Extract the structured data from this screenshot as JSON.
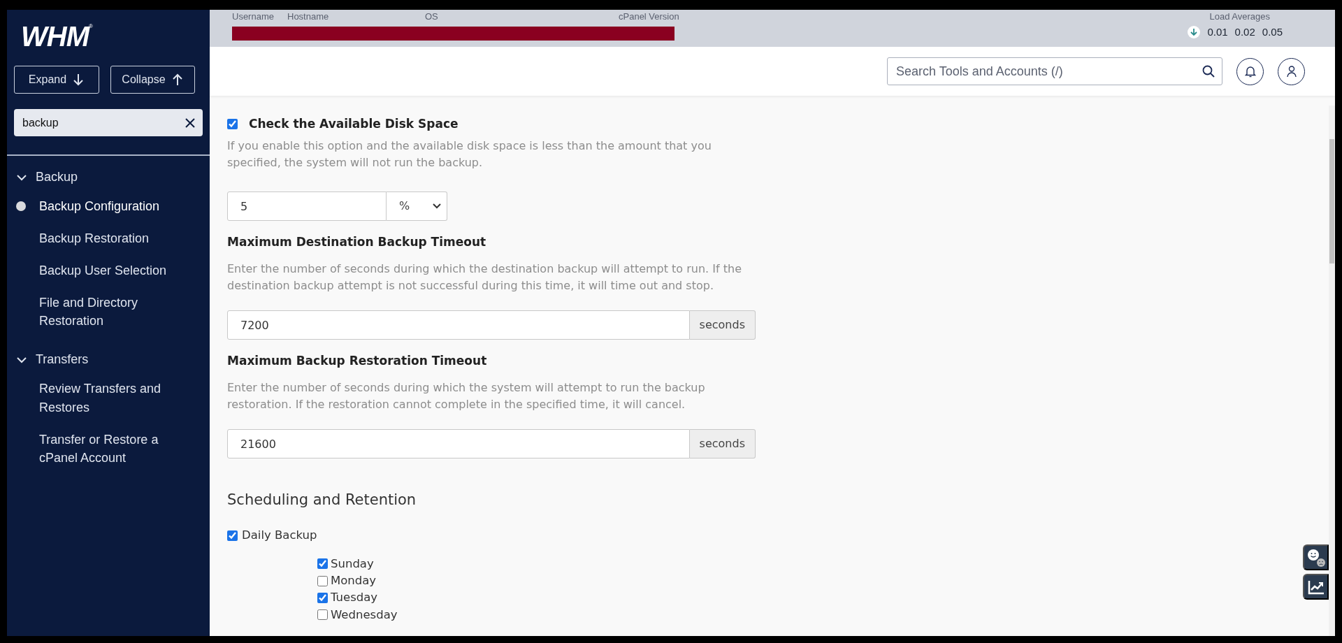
{
  "sidebar": {
    "logo": "WHM",
    "logo_mark": "®",
    "expand_button": "Expand",
    "collapse_button": "Collapse",
    "filter": {
      "value": "backup"
    },
    "groups": [
      {
        "label": "Backup",
        "expanded": true,
        "children": [
          {
            "label": "Backup Configuration",
            "selected": true
          },
          {
            "label": "Backup Restoration",
            "selected": false
          },
          {
            "label": "Backup User Selection",
            "selected": false
          },
          {
            "label": "File and Directory Restoration",
            "selected": false
          }
        ]
      },
      {
        "label": "Transfers",
        "expanded": true,
        "children": [
          {
            "label": "Review Transfers and Restores",
            "selected": false
          },
          {
            "label": "Transfer or Restore a cPanel Account",
            "selected": false
          }
        ]
      }
    ]
  },
  "server_info": {
    "columns": [
      "Username",
      "Hostname",
      "OS",
      "cPanel Version"
    ],
    "load_averages": {
      "label": "Load Averages",
      "values": [
        "0.01",
        "0.02",
        "0.05"
      ]
    }
  },
  "search": {
    "placeholder": "Search Tools and Accounts (/)"
  },
  "disk_space": {
    "label": "Check the Available Disk Space",
    "checked": true,
    "description": "If you enable this option and the available disk space is less than the amount that you specified, the system will not run the backup.",
    "value": "5",
    "unit": "%"
  },
  "timeouts": [
    {
      "heading": "Maximum Destination Backup Timeout",
      "description": "Enter the number of seconds during which the destination backup will attempt to run. If the destination backup attempt is not successful during this time, it will time out and stop.",
      "value": "7200",
      "unit": "seconds"
    },
    {
      "heading": "Maximum Backup Restoration Timeout",
      "description": "Enter the number of seconds during which the system will attempt to run the backup restoration. If the restoration cannot complete in the specified time, it will cancel.",
      "value": "21600",
      "unit": "seconds"
    }
  ],
  "scheduling": {
    "heading": "Scheduling and Retention",
    "daily_backup": {
      "label": "Daily Backup",
      "checked": true
    },
    "days": [
      {
        "label": "Sunday",
        "checked": true
      },
      {
        "label": "Monday",
        "checked": false
      },
      {
        "label": "Tuesday",
        "checked": true
      },
      {
        "label": "Wednesday",
        "checked": false
      }
    ]
  }
}
